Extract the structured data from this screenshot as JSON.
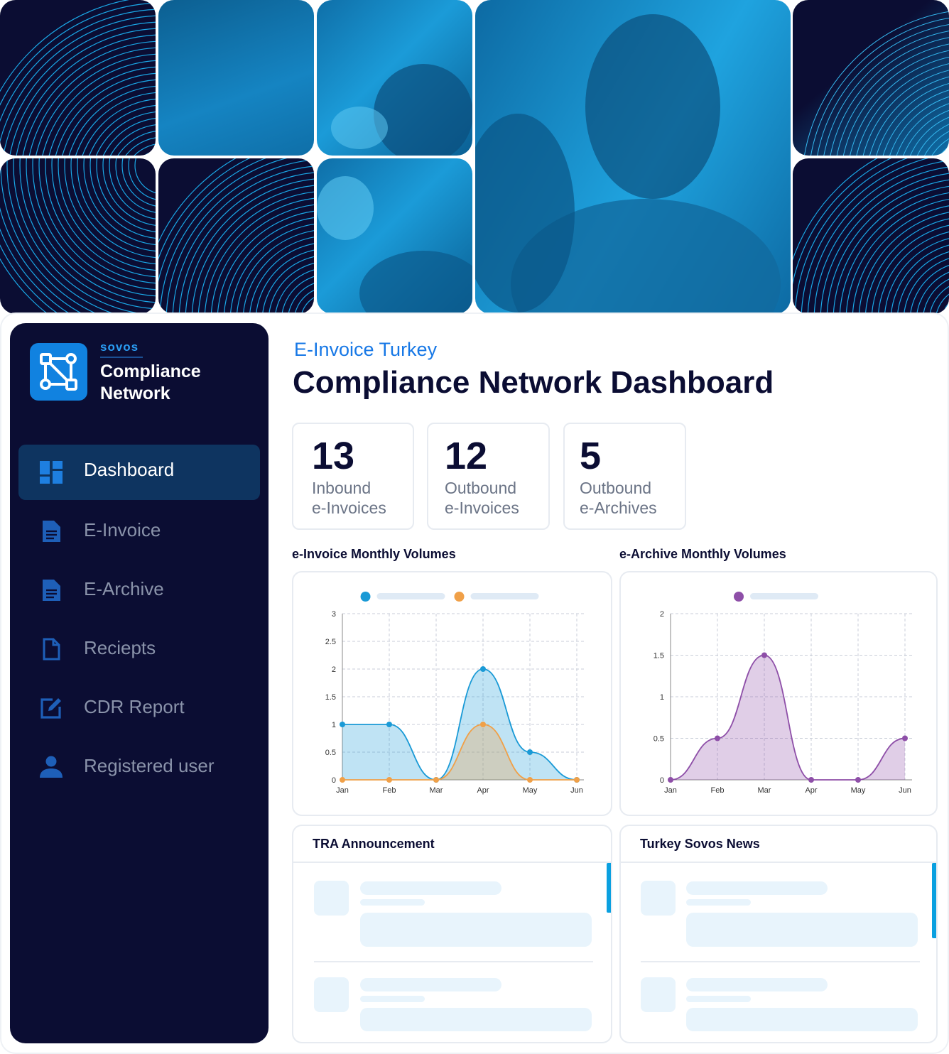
{
  "brand": {
    "company": "sovos",
    "product": "Compliance Network"
  },
  "sidebar": {
    "items": [
      {
        "label": "Dashboard",
        "icon": "dashboard-icon",
        "active": true
      },
      {
        "label": "E-Invoice",
        "icon": "document-icon",
        "active": false
      },
      {
        "label": "E-Archive",
        "icon": "document-icon",
        "active": false
      },
      {
        "label": "Reciepts",
        "icon": "file-outline-icon",
        "active": false
      },
      {
        "label": "CDR Report",
        "icon": "edit-icon",
        "active": false
      },
      {
        "label": "Registered user",
        "icon": "user-icon",
        "active": false
      }
    ]
  },
  "header": {
    "eyebrow": "E-Invoice Turkey",
    "title": "Compliance Network Dashboard"
  },
  "stats": [
    {
      "value": "13",
      "label_line1": "Inbound",
      "label_line2": "e-Invoices"
    },
    {
      "value": "12",
      "label_line1": "Outbound",
      "label_line2": "e-Invoices"
    },
    {
      "value": "5",
      "label_line1": "Outbound",
      "label_line2": "e-Archives"
    }
  ],
  "panels": {
    "invoice_chart_title": "e-Invoice Monthly Volumes",
    "archive_chart_title": "e-Archive Monthly Volumes",
    "announcement_title": "TRA Announcement",
    "news_title": "Turkey Sovos News"
  },
  "colors": {
    "navy": "#0b0d33",
    "accent": "#1778e6",
    "series_blue": "#1a9ad6",
    "series_orange": "#f0a048",
    "series_purple": "#8e4fa8"
  },
  "chart_data": [
    {
      "type": "area",
      "title": "e-Invoice Monthly Volumes",
      "categories": [
        "Jan",
        "Feb",
        "Mar",
        "Apr",
        "May",
        "Jun"
      ],
      "ylim": [
        0,
        3
      ],
      "yticks": [
        "0",
        "0.5",
        "1",
        "1.5",
        "2",
        "2.5",
        "3"
      ],
      "grid": true,
      "legend": "top-center",
      "series": [
        {
          "values": [
            1,
            1,
            0,
            2,
            0.5,
            0
          ],
          "color": "#1a9ad6"
        },
        {
          "values": [
            0,
            0,
            0,
            1,
            0,
            0
          ],
          "color": "#f0a048"
        }
      ]
    },
    {
      "type": "area",
      "title": "e-Archive Monthly Volumes",
      "categories": [
        "Jan",
        "Feb",
        "Mar",
        "Apr",
        "May",
        "Jun"
      ],
      "ylim": [
        0,
        2
      ],
      "yticks": [
        "0",
        "0.5",
        "1",
        "1.5",
        "2"
      ],
      "grid": true,
      "legend": "top-center",
      "series": [
        {
          "values": [
            0,
            0.5,
            1.5,
            0,
            0,
            0.5
          ],
          "color": "#8e4fa8"
        }
      ]
    }
  ]
}
